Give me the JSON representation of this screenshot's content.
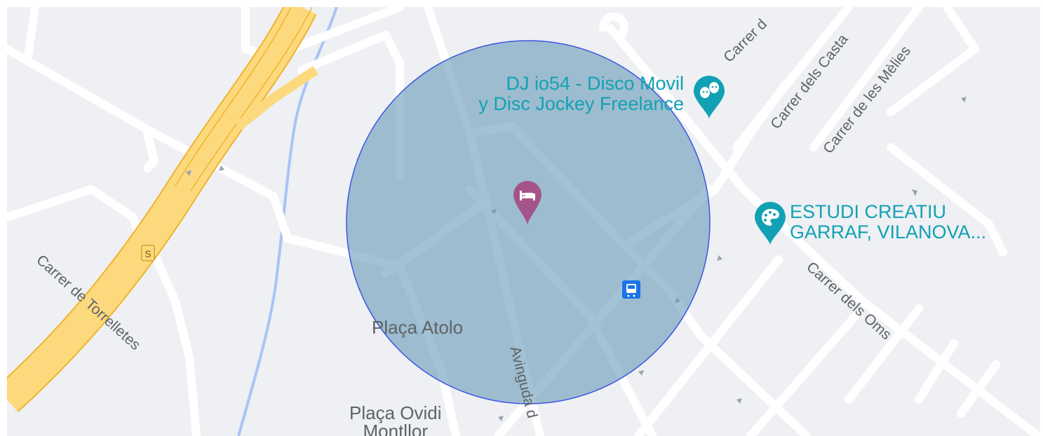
{
  "colors": {
    "background": "#eef0f3",
    "road": "#ffffff",
    "highway": "#fdd97e",
    "highway_border": "#f0b429",
    "river": "#a9c4f5",
    "radius_fill": "#6b9cb8",
    "radius_stroke": "#3b55e6",
    "poi_teal": "#12a1b4",
    "hotel_pin": "#a5548a",
    "transit": "#1a73e8",
    "street_label": "#5f6368"
  },
  "streets": {
    "torrelletes": "Carrer de Torrelletes",
    "oms": "Carrer dels Oms",
    "melies": "Carrer de les Mèlies",
    "castanyers": "Carrer dels Casta",
    "carrer_top": "Carrer d",
    "avinguda": "Avinguda d"
  },
  "places": {
    "placa_atolo": "Plaça Atolo",
    "placa_ovidi_line1": "Plaça Ovidi",
    "placa_ovidi_line2": "Montllor"
  },
  "pois": [
    {
      "name_line1": "DJ io54 - Disco Movil",
      "name_line2": "y Disc Jockey Freelance",
      "icon": "theater-masks-icon"
    },
    {
      "name_line1": "ESTUDI CREATIU",
      "name_line2": "GARRAF, VILANOVA...",
      "icon": "palette-icon"
    }
  ],
  "markers": {
    "hotel": "bed-icon",
    "bus_stop": "bus-icon",
    "highway_shield": "S"
  }
}
